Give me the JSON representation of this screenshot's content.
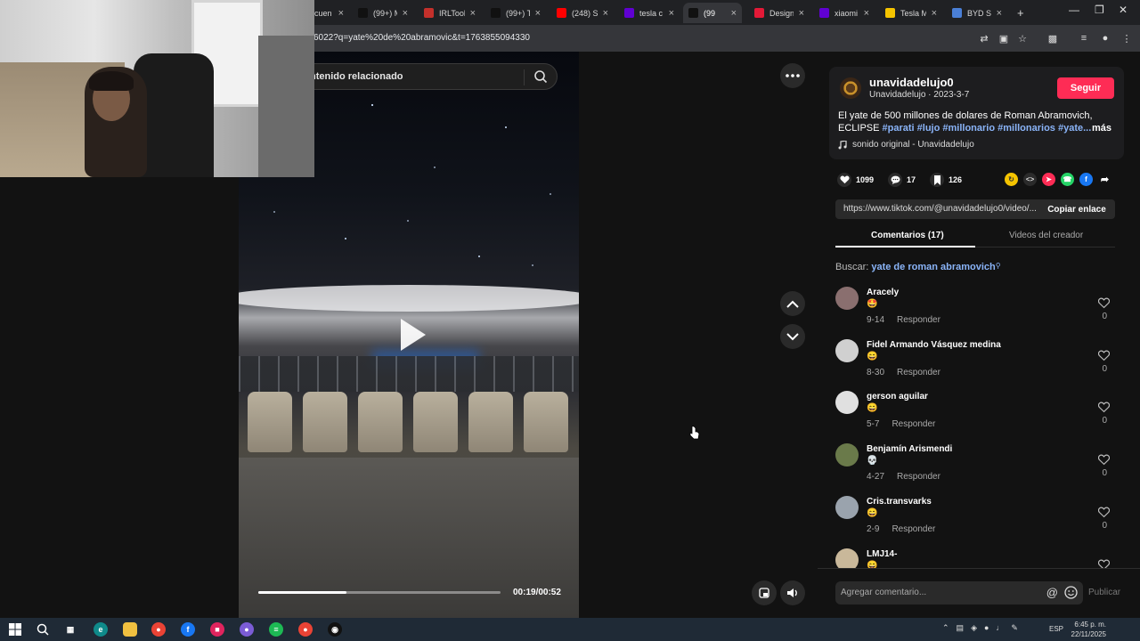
{
  "browser": {
    "tabs": [
      {
        "title": "cuen",
        "color": "#444"
      },
      {
        "title": "(99+) M",
        "color": "#111"
      },
      {
        "title": "IRLTool",
        "color": "#c4302b"
      },
      {
        "title": "(99+) T",
        "color": "#111"
      },
      {
        "title": "(248) S",
        "color": "#ff0000"
      },
      {
        "title": "tesla c",
        "color": "#6001d2"
      },
      {
        "title": "(99",
        "color": "#111"
      },
      {
        "title": "Design",
        "color": "#e31937"
      },
      {
        "title": "xiaomi",
        "color": "#6001d2"
      },
      {
        "title": "Tesla M",
        "color": "#f5c400"
      },
      {
        "title": "BYD Se",
        "color": "#4a7fd6"
      }
    ],
    "new_tab": "+",
    "url": "6022?q=yate%20de%20abramovic&t=1763855094330"
  },
  "search": {
    "text": "ntenido relacionado"
  },
  "video": {
    "time": "00:19/00:52",
    "progress": 0.365
  },
  "creator": {
    "username": "unavidadelujo0",
    "sub": "Unavidadelujo · 2023-3-7",
    "follow_label": "Seguir",
    "desc_text": "El yate de 500 millones de dolares de Roman Abramovich, ECLIPSE ",
    "desc_tags": "#parati #lujo #millonario #millonarios #yate...",
    "more_label": "más",
    "sound": "sonido original - Unavidadelujo"
  },
  "stats": {
    "likes": "1099",
    "comments": "17",
    "saves": "126"
  },
  "share": {
    "link": "https://www.tiktok.com/@unavidadelujo0/video/...",
    "copy_label": "Copiar enlace"
  },
  "panel_tabs": {
    "comments": "Comentarios (17)",
    "creator_videos": "Videos del creador"
  },
  "suggest": {
    "prefix": "Buscar: ",
    "query": "yate de roman abramovich"
  },
  "comments": [
    {
      "name": "Aracely",
      "emoji": "🤩",
      "date": "9-14",
      "reply": "Responder",
      "likes": "0",
      "avatar": "#8a6f6f"
    },
    {
      "name": "Fidel Armando Vásquez medina",
      "emoji": "😄",
      "date": "8-30",
      "reply": "Responder",
      "likes": "0",
      "avatar": "#d0d0d0"
    },
    {
      "name": "gerson aguilar",
      "emoji": "😄",
      "date": "5-7",
      "reply": "Responder",
      "likes": "0",
      "avatar": "#e0e0e0"
    },
    {
      "name": "Benjamín Arismendi",
      "emoji": "💀",
      "date": "4-27",
      "reply": "Responder",
      "likes": "0",
      "avatar": "#6a7a4a"
    },
    {
      "name": "Cris.transvarks",
      "emoji": "😄",
      "date": "2-9",
      "reply": "Responder",
      "likes": "0",
      "avatar": "#9aa3ad"
    },
    {
      "name": "LMJ14-",
      "emoji": "😄",
      "date": "",
      "reply": "",
      "likes": "",
      "avatar": "#c9b89a"
    }
  ],
  "comment_bar": {
    "placeholder": "Agregar comentario...",
    "at": "@",
    "publish": "Publicar"
  },
  "taskbar": {
    "lang": "ESP",
    "time": "6:45 p. m.",
    "date": "22/11/2025"
  }
}
